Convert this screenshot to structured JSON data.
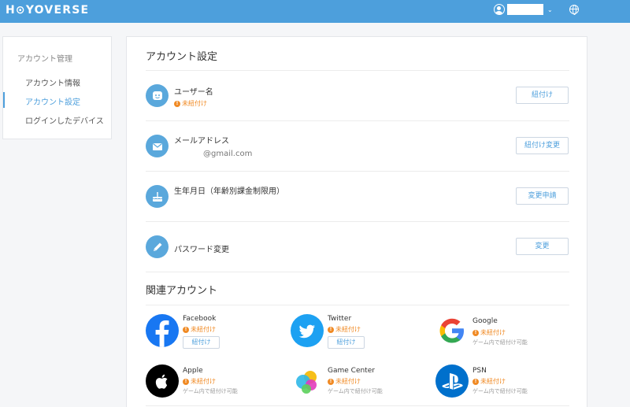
{
  "header": {
    "logo": "H⊙YOVERSE",
    "user_icon": "user-circle-icon",
    "dropdown_icon": "chevron-down-icon",
    "language_icon": "globe-icon",
    "background_color": "#4d9fdc"
  },
  "sidebar": {
    "title": "アカウント管理",
    "items": [
      {
        "label": "アカウント情報",
        "active": false
      },
      {
        "label": "アカウント設定",
        "active": true
      },
      {
        "label": "ログインしたデバイス",
        "active": false
      }
    ]
  },
  "settings": {
    "title": "アカウント設定",
    "rows": [
      {
        "icon": "face-icon",
        "label": "ユーザー名",
        "status": "未紐付け",
        "button": "紐付け"
      },
      {
        "icon": "envelope-icon",
        "label": "メールアドレス",
        "value": "@gmail.com",
        "button": "紐付け変更"
      },
      {
        "icon": "cake-icon",
        "label": "生年月日（年齢別課金制限用）",
        "button": "変更申請"
      },
      {
        "icon": "pencil-icon",
        "label": "パスワード変更",
        "button": "変更"
      }
    ]
  },
  "related": {
    "title": "関連アカウント",
    "accounts": [
      {
        "name": "Facebook",
        "icon": "facebook-icon",
        "status": "未紐付け",
        "button": "紐付け"
      },
      {
        "name": "Twitter",
        "icon": "twitter-bird-icon",
        "status": "未紐付け",
        "button": "紐付け"
      },
      {
        "name": "Google",
        "icon": "google-icon",
        "status": "未紐付け",
        "note": "ゲーム内で紐付け可能"
      },
      {
        "name": "Apple",
        "icon": "apple-icon",
        "status": "未紐付け",
        "note": "ゲーム内で紐付け可能"
      },
      {
        "name": "Game Center",
        "icon": "game-center-icon",
        "status": "未紐付け",
        "note": "ゲーム内で紐付け可能"
      },
      {
        "name": "PSN",
        "icon": "playstation-icon",
        "status": "未紐付け",
        "note": "ゲーム内で紐付け可能"
      }
    ]
  },
  "colors": {
    "accent": "#4d9fdc",
    "warning": "#f08a24"
  }
}
